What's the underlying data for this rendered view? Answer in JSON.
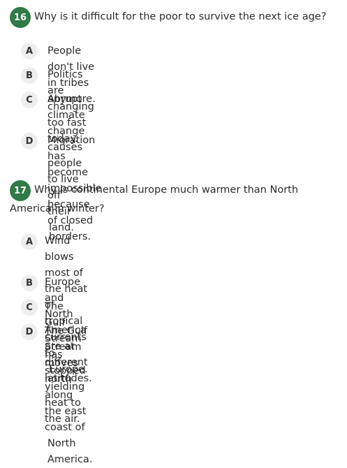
{
  "questions": [
    {
      "number": "16",
      "text": "Why is it difficult for the poor to survive the next ice age?",
      "options": [
        {
          "letter": "A",
          "line1": "People don't live in tribes anymore.",
          "line2": ""
        },
        {
          "letter": "B",
          "line1": "Politics are changing too fast today.",
          "line2": ""
        },
        {
          "letter": "C",
          "line1": "Abrupt climate change causes people to live off their",
          "line2": "land."
        },
        {
          "letter": "D",
          "line1": "Migration has become impossible because of closed",
          "line2": "borders."
        }
      ]
    },
    {
      "number": "17",
      "text_line1": "Why is continental Europe much warmer than North",
      "text_line2": "America in winter?",
      "options": [
        {
          "letter": "A",
          "line1": "Wind blows most of the heat of tropical currents to",
          "line2": "Europe."
        },
        {
          "letter": "B",
          "line1": "Europe and North America are at different latitudes.",
          "line2": ""
        },
        {
          "letter": "C",
          "line1": "The Gulf Stream has stopped yielding heat to the air.",
          "line2": ""
        },
        {
          "letter": "D",
          "line1": "The Gulf Stream moves north along the east coast of",
          "line2": "North America."
        }
      ]
    }
  ],
  "colors": {
    "badge": "#2f7a46",
    "option_letter_bg": "#eeeeee"
  }
}
